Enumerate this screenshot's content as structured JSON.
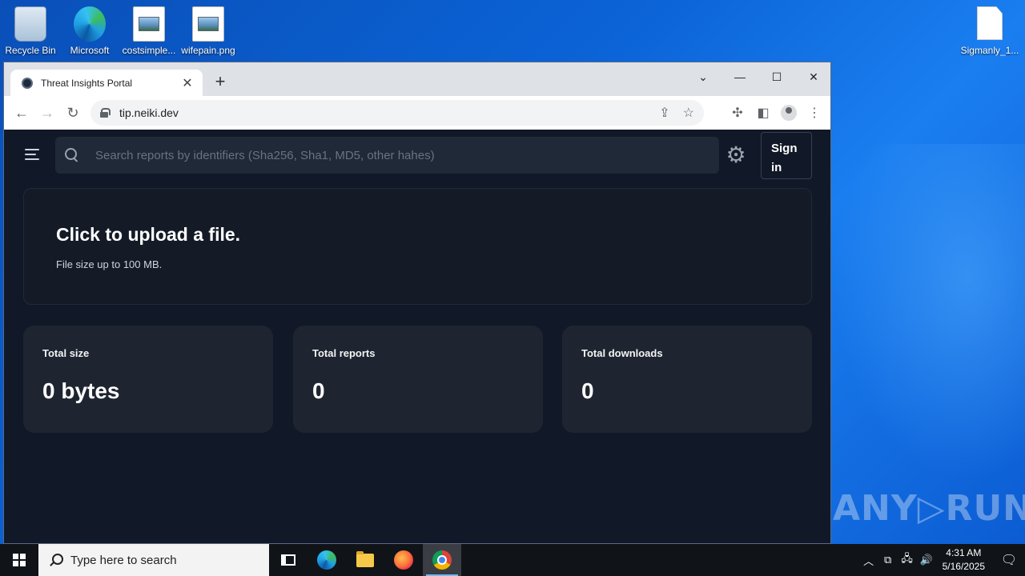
{
  "desktop": {
    "icons": [
      {
        "label": "Recycle Bin",
        "icon": "recycle-bin-icon"
      },
      {
        "label": "Microsoft",
        "icon": "edge-icon"
      },
      {
        "label": "costsimple...",
        "icon": "image-file-icon"
      },
      {
        "label": "wifepain.png",
        "icon": "image-file-icon"
      },
      {
        "label": "Sigmanly_1...",
        "icon": "blank-file-icon"
      }
    ],
    "watermark": "ANY▷RUN"
  },
  "browser": {
    "tab_title": "Threat Insights Portal",
    "url": "tip.neiki.dev"
  },
  "page": {
    "search_placeholder": "Search reports by identifiers (Sha256, Sha1, MD5, other hahes)",
    "sign_in": "Sign in",
    "upload_title": "Click to upload a file.",
    "upload_subtitle": "File size up to 100 MB.",
    "stats": [
      {
        "label": "Total size",
        "value": "0 bytes"
      },
      {
        "label": "Total reports",
        "value": "0"
      },
      {
        "label": "Total downloads",
        "value": "0"
      }
    ]
  },
  "taskbar": {
    "search_placeholder": "Type here to search",
    "time": "4:31 AM",
    "date": "5/16/2025"
  },
  "colors": {
    "page_bg": "#111827",
    "card_bg": "#1f2530",
    "desktop_blue": "#0b63d6"
  }
}
